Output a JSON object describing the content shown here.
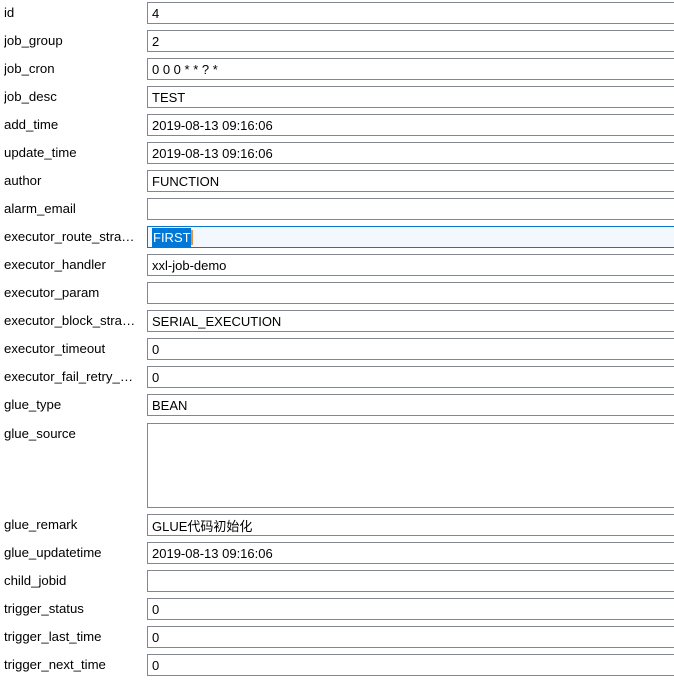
{
  "form": {
    "focused_field_index": 7,
    "colors": {
      "input_border": "#828790",
      "focus_border": "#0b76d0",
      "focus_background": "#f2f8fd",
      "selection_background": "#0078d7",
      "selection_text": "#ffffff",
      "caret": "#e0924a",
      "label_text": "#000000",
      "page_background": "#ffffff"
    },
    "fields": [
      {
        "label": "id",
        "value": "4",
        "type": "text",
        "focused": false,
        "selected": false
      },
      {
        "label": "job_group",
        "value": "2",
        "type": "text",
        "focused": false,
        "selected": false
      },
      {
        "label": "job_cron",
        "value": "0 0 0 * * ? *",
        "type": "text",
        "focused": false,
        "selected": false
      },
      {
        "label": "job_desc",
        "value": "TEST",
        "type": "text",
        "focused": false,
        "selected": false
      },
      {
        "label": "add_time",
        "value": "2019-08-13 09:16:06",
        "type": "text",
        "focused": false,
        "selected": false
      },
      {
        "label": "update_time",
        "value": "2019-08-13 09:16:06",
        "type": "text",
        "focused": false,
        "selected": false
      },
      {
        "label": "author",
        "value": "FUNCTION",
        "type": "text",
        "focused": false,
        "selected": false
      },
      {
        "label": "alarm_email",
        "value": "",
        "type": "text",
        "focused": false,
        "selected": false
      },
      {
        "label": "executor_route_stra…",
        "value": "FIRST",
        "type": "text",
        "focused": true,
        "selected": true
      },
      {
        "label": "executor_handler",
        "value": "xxl-job-demo",
        "type": "text",
        "focused": false,
        "selected": false
      },
      {
        "label": "executor_param",
        "value": "",
        "type": "text",
        "focused": false,
        "selected": false
      },
      {
        "label": "executor_block_stra…",
        "value": "SERIAL_EXECUTION",
        "type": "text",
        "focused": false,
        "selected": false
      },
      {
        "label": "executor_timeout",
        "value": "0",
        "type": "text",
        "focused": false,
        "selected": false
      },
      {
        "label": "executor_fail_retry_…",
        "value": "0",
        "type": "text",
        "focused": false,
        "selected": false
      },
      {
        "label": "glue_type",
        "value": "BEAN",
        "type": "text",
        "focused": false,
        "selected": false
      },
      {
        "label": "glue_source",
        "value": "",
        "type": "textarea",
        "focused": false,
        "selected": false
      },
      {
        "label": "glue_remark",
        "value": "GLUE代码初始化",
        "type": "text",
        "focused": false,
        "selected": false
      },
      {
        "label": "glue_updatetime",
        "value": "2019-08-13 09:16:06",
        "type": "text",
        "focused": false,
        "selected": false
      },
      {
        "label": "child_jobid",
        "value": "",
        "type": "text",
        "focused": false,
        "selected": false
      },
      {
        "label": "trigger_status",
        "value": "0",
        "type": "text",
        "focused": false,
        "selected": false
      },
      {
        "label": "trigger_last_time",
        "value": "0",
        "type": "text",
        "focused": false,
        "selected": false
      },
      {
        "label": "trigger_next_time",
        "value": "0",
        "type": "text",
        "focused": false,
        "selected": false
      }
    ]
  }
}
